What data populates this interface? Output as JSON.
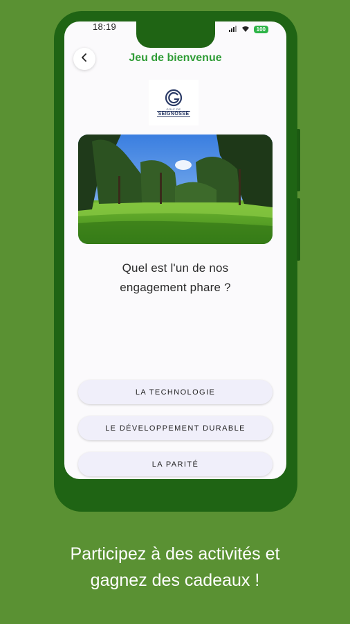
{
  "status_bar": {
    "time": "18:19",
    "battery": "100"
  },
  "header": {
    "title": "Jeu de bienvenue"
  },
  "logo": {
    "small_text": "GOLF DE",
    "name": "SEIGNOSSE"
  },
  "question": {
    "line1": "Quel est l'un de nos",
    "line2": "engagement phare ?"
  },
  "answers": [
    {
      "label": "LA TECHNOLOGIE"
    },
    {
      "label": "LE DÉVELOPPEMENT DURABLE"
    },
    {
      "label": "LA PARITÉ"
    }
  ],
  "caption": {
    "line1": "Participez à des activités et",
    "line2": "gagnez des cadeaux !"
  },
  "colors": {
    "background": "#5a9133",
    "phone": "#1f6414",
    "title": "#2f9c36"
  }
}
